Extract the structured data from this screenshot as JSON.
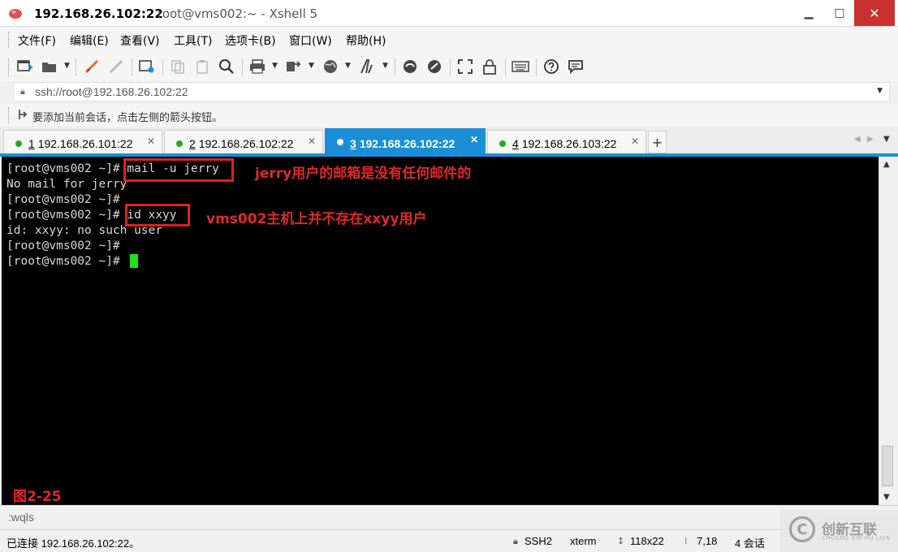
{
  "window": {
    "title_host": "192.168.26.102:22",
    "title_rest": "root@vms002:~ - Xshell 5",
    "minimize": "▁",
    "maximize": "□",
    "close": "✕"
  },
  "menu": {
    "items": [
      "文件(F)",
      "编辑(E)",
      "查看(V)",
      "工具(T)",
      "选项卡(B)",
      "窗口(W)",
      "帮助(H)"
    ]
  },
  "address": {
    "value": "ssh://root@192.168.26.102:22"
  },
  "hint": {
    "text": "要添加当前会话，点击左侧的箭头按钮。"
  },
  "tabs": [
    {
      "index": "1",
      "label": "192.168.26.101:22",
      "active": false
    },
    {
      "index": "2",
      "label": "192.168.26.102:22",
      "active": false
    },
    {
      "index": "3",
      "label": "192.168.26.102:22",
      "active": true
    },
    {
      "index": "4",
      "label": "192.168.26.103:22",
      "active": false
    }
  ],
  "tab_add": "+",
  "terminal": {
    "lines": [
      "[root@vms002 ~]# mail -u jerry",
      "No mail for jerry",
      "[root@vms002 ~]#",
      "[root@vms002 ~]# id xxyy",
      "id: xxyy: no such user",
      "[root@vms002 ~]#",
      "[root@vms002 ~]# "
    ],
    "annotations": [
      "jerry用户的邮箱是没有任何邮件的",
      "vms002主机上并不存在xxyy用户"
    ],
    "figure_label": "图2-25"
  },
  "command_line": {
    "value": ":wqls"
  },
  "status": {
    "connection": "已连接 192.168.26.102:22。",
    "protocol": "SSH2",
    "terminal_type": "xterm",
    "size": "118x22",
    "cursor_pos": "7,18",
    "sessions": "4 会话"
  },
  "watermark": {
    "name_cn": "创新互联",
    "name_en": "CHUANG XIN HU LIAN"
  },
  "colors": {
    "accent": "#1a8fd8",
    "annotation": "#e02828",
    "cursor": "#22e022",
    "terminal_bg": "#000000"
  }
}
